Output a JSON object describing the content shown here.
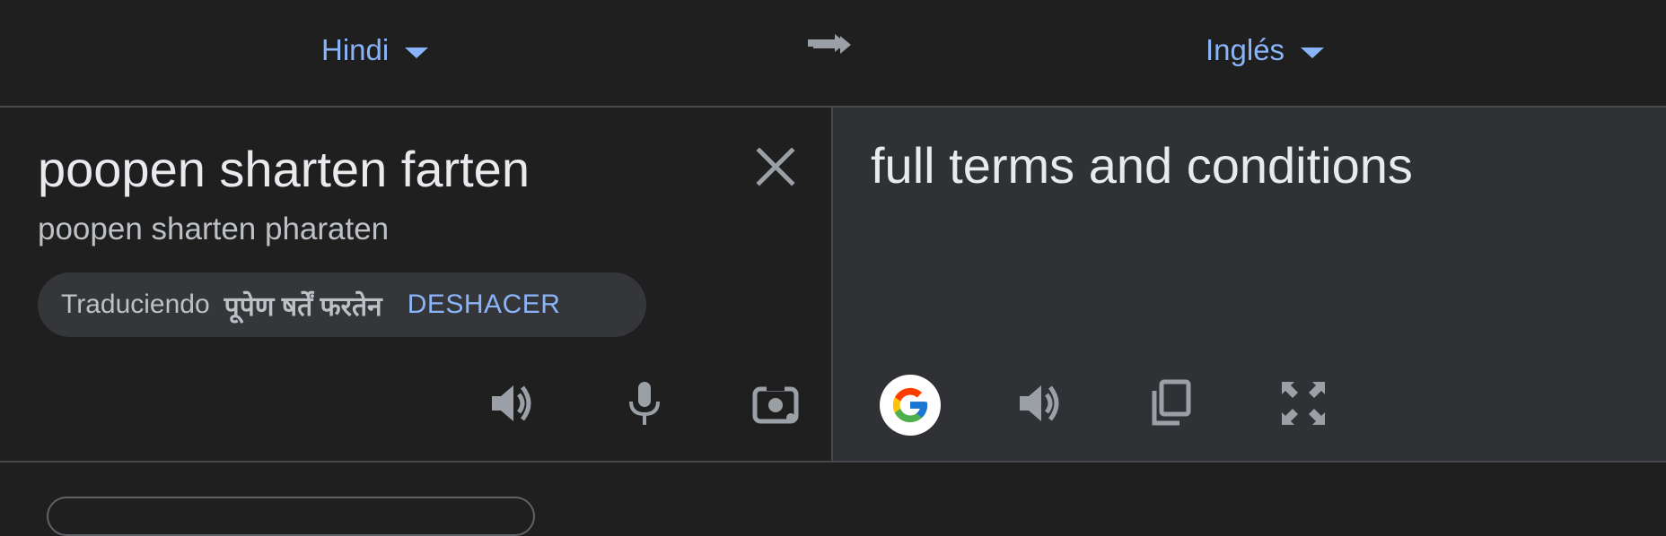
{
  "header": {
    "source_lang": "Hindi",
    "target_lang": "Inglés"
  },
  "source": {
    "text": "poopen sharten farten",
    "transliteration": "poopen sharten pharaten",
    "chip_label": "Traduciendo",
    "chip_original": "पूपेण षर्तें फरतेन",
    "chip_undo": "DESHACER"
  },
  "target": {
    "text": "full terms and conditions"
  },
  "icons": {
    "swap": "swap-languages-icon",
    "clear": "close-icon",
    "listen_source": "speaker-icon",
    "mic": "microphone-icon",
    "camera": "camera-icon",
    "google": "google-icon",
    "listen_target": "speaker-icon",
    "copy": "copy-icon",
    "fullscreen": "fullscreen-icon"
  },
  "colors": {
    "accent": "#8ab4f8",
    "background": "#1f1f1f",
    "output_panel": "#303134",
    "icon": "#9aa0a6"
  }
}
